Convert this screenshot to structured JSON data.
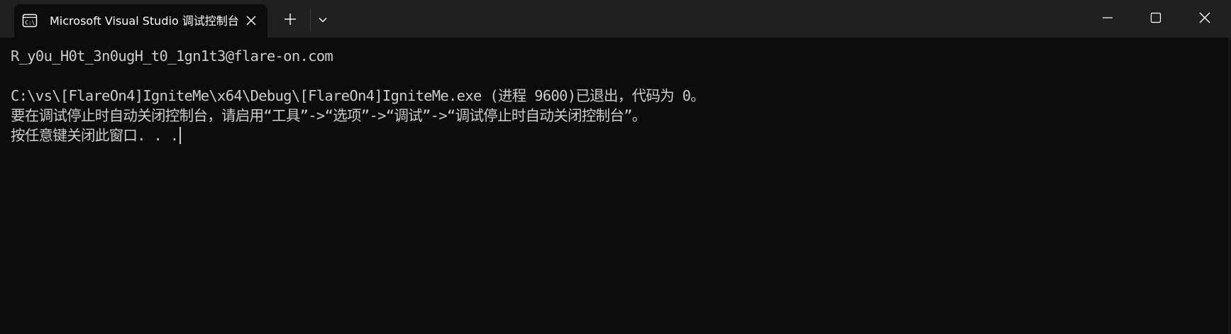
{
  "titlebar": {
    "tab": {
      "title": "Microsoft Visual Studio 调试控制台",
      "icon": "terminal-icon"
    },
    "new_tab_icon": "plus-icon",
    "dropdown_icon": "chevron-down-icon",
    "window_controls": {
      "minimize_icon": "minimize-icon",
      "maximize_icon": "maximize-icon",
      "close_icon": "close-icon"
    }
  },
  "terminal": {
    "lines": [
      "R_y0u_H0t_3n0ugH_t0_1gn1t3@flare-on.com",
      "",
      "C:\\vs\\[FlareOn4]IgniteMe\\x64\\Debug\\[FlareOn4]IgniteMe.exe (进程 9600)已退出，代码为 0。",
      "要在调试停止时自动关闭控制台，请启用“工具”->“选项”->“调试”->“调试停止时自动关闭控制台”。",
      "按任意键关闭此窗口. . ."
    ]
  },
  "colors": {
    "titlebar_bg": "#202020",
    "terminal_bg": "#0c0c0c",
    "text": "#cccccc"
  }
}
